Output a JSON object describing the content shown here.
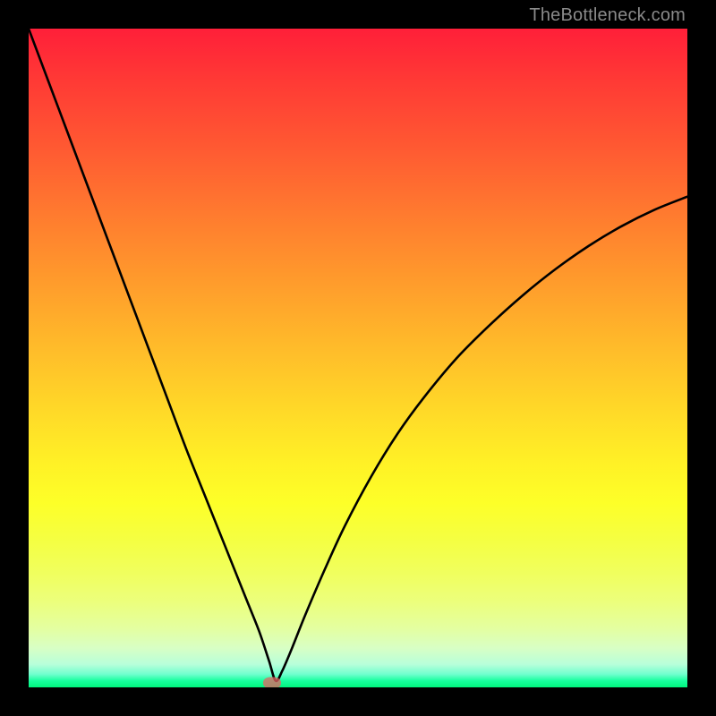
{
  "watermark": "TheBottleneck.com",
  "colors": {
    "frame": "#000000",
    "curve": "#000000",
    "marker": "rgba(230,98,98,0.75)"
  },
  "chart_data": {
    "type": "line",
    "title": "",
    "xlabel": "",
    "ylabel": "",
    "xlim": [
      0,
      100
    ],
    "ylim": [
      0,
      100
    ],
    "annotations": [
      {
        "name": "min-marker",
        "x": 37,
        "y": 0
      }
    ],
    "series": [
      {
        "name": "bottleneck-curve",
        "x": [
          0,
          3,
          6,
          9,
          12,
          15,
          18,
          21,
          24,
          27,
          30,
          33,
          35,
          36.5,
          37.5,
          38.5,
          40,
          42,
          45,
          48,
          52,
          56,
          60,
          65,
          70,
          75,
          80,
          85,
          90,
          95,
          100
        ],
        "y": [
          100,
          92,
          84,
          76,
          68,
          60,
          52,
          44,
          36,
          28.5,
          21,
          13.5,
          8.5,
          4,
          1,
          2.5,
          6,
          11,
          18,
          24.5,
          32,
          38.5,
          44,
          50,
          55,
          59.5,
          63.5,
          67,
          70,
          72.5,
          74.5
        ]
      }
    ]
  }
}
